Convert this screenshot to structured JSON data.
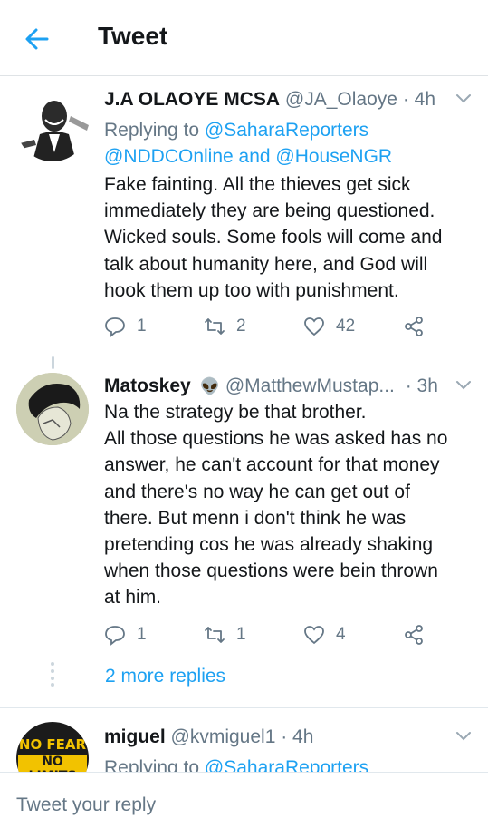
{
  "header": {
    "title": "Tweet"
  },
  "tweets": [
    {
      "name": "J.A OLAOYE MCSA",
      "handle": "@JA_Olaoye",
      "time": "· 4h",
      "reply_prefix": "Replying to ",
      "reply_mentions_line1": "@SaharaReporters",
      "reply_mentions_line2": "@NDDCOnline and @HouseNGR",
      "text": "Fake fainting. All the thieves get sick\nimmediately they are being questioned.\nWicked souls. Some fools will come and\ntalk about humanity here, and God will\nhook them up too with punishment.",
      "replies": "1",
      "retweets": "2",
      "likes": "42"
    },
    {
      "name": "Matoskey",
      "emoji": "👽",
      "handle": "@MatthewMustap...",
      "time": "· 3h",
      "text": "Na the strategy be that brother.\nAll those questions he was asked has no\nanswer, he can't account for that money\nand there's no way he can get out of\nthere. But menn i don't think he was\npretending cos he was already shaking\nwhen those questions were bein thrown\nat him.",
      "replies": "1",
      "retweets": "1",
      "likes": "4",
      "more_replies": "2 more replies"
    },
    {
      "name": "miguel",
      "handle": "@kvmiguel1",
      "time": "· 4h",
      "reply_prefix": "Replying to ",
      "reply_mentions_line1": "@SaharaReporters",
      "avatar_text_1": "NO FEAR",
      "avatar_text_2": "NO LIMITS"
    }
  ],
  "reply_bar": {
    "placeholder": "Tweet your reply"
  },
  "colors": {
    "accent": "#1da1f2",
    "secondary_text": "#657786",
    "primary_text": "#14171a",
    "divider": "#e1e8ed"
  }
}
